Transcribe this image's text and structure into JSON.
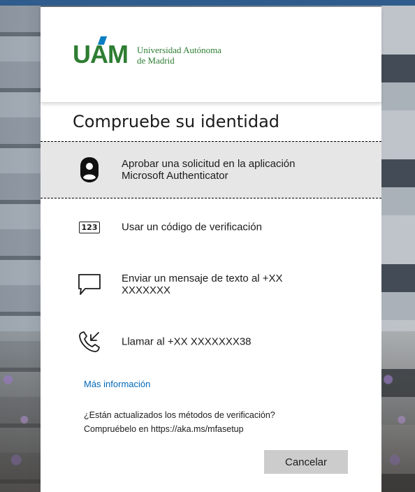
{
  "organization": {
    "logo_letters": "UAM",
    "name_line1": "Universidad Autónoma",
    "name_line2": "de Madrid",
    "brand_color": "#2e7d32",
    "accent_color": "#0a7ec2"
  },
  "page": {
    "title": "Compruebe su identidad"
  },
  "options": [
    {
      "icon": "authenticator-lock-icon",
      "label": "Aprobar una solicitud en la aplicación\nMicrosoft Authenticator",
      "selected": true
    },
    {
      "icon": "verification-code-icon",
      "icon_text": "123",
      "label": "Usar un código de verificación",
      "selected": false
    },
    {
      "icon": "sms-message-icon",
      "label": "Enviar un mensaje de texto al +XX\nXXXXXXX",
      "selected": false
    },
    {
      "icon": "phone-call-icon",
      "label": "Llamar al +XX XXXXXXX38",
      "selected": false
    }
  ],
  "more_info_link": "Más información",
  "footer_note": {
    "line1": "¿Están actualizados los métodos de verificación?",
    "line2": "Compruébelo en https://aka.ms/mfasetup"
  },
  "buttons": {
    "cancel": "Cancelar"
  },
  "colors": {
    "link": "#0067b8",
    "selected_bg": "#e6e6e6",
    "button_bg": "#cccccc"
  }
}
